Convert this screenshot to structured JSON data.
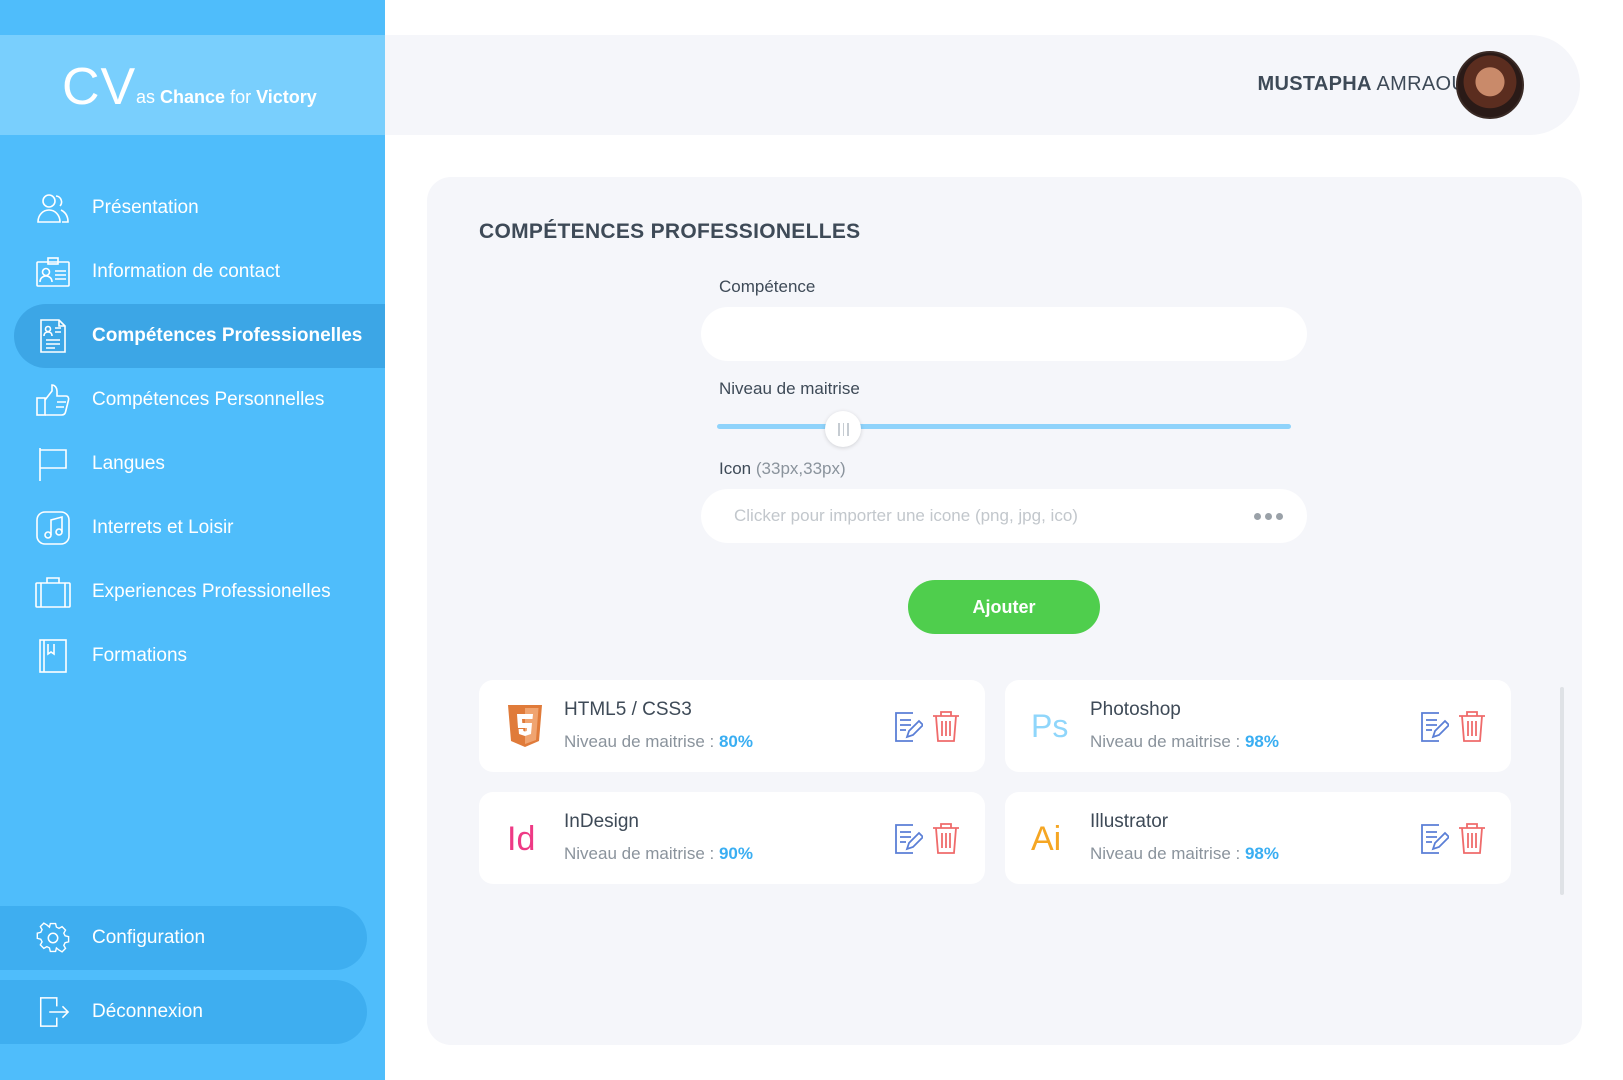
{
  "app": {
    "logo_main": "CV",
    "logo_as": "as",
    "logo_chance": "Chance",
    "logo_for": "for",
    "logo_victory": "Victory"
  },
  "sidebar": {
    "items": [
      {
        "label": "Présentation",
        "icon": "users-icon"
      },
      {
        "label": "Information de contact",
        "icon": "contact-card-icon"
      },
      {
        "label": "Compétences Professionelles",
        "icon": "document-icon",
        "active": true
      },
      {
        "label": "Compétences Personnelles",
        "icon": "thumbs-up-icon"
      },
      {
        "label": "Langues",
        "icon": "flag-icon"
      },
      {
        "label": "Interrets et Loisir",
        "icon": "music-icon"
      },
      {
        "label": "Experiences Professionelles",
        "icon": "briefcase-icon"
      },
      {
        "label": "Formations",
        "icon": "book-icon"
      }
    ],
    "config_label": "Configuration",
    "logout_label": "Déconnexion"
  },
  "header": {
    "first_name": "MUSTAPHA",
    "last_name": "AMRAOUI"
  },
  "form": {
    "title": "COMPÉTENCES PROFESSIONELLES",
    "skill_label": "Compétence",
    "skill_value": "",
    "level_label": "Niveau de maitrise",
    "level_value": 0.22,
    "icon_label": "Icon",
    "icon_hint": "(33px,33px)",
    "icon_placeholder": "Clicker pour importer une icone (png, jpg, ico)",
    "submit_label": "Ajouter"
  },
  "skills": [
    {
      "name": "HTML5 / CSS3",
      "level_label": "Niveau de maitrise :",
      "level": "80%",
      "icon": "html5-icon"
    },
    {
      "name": "Photoshop",
      "level_label": "Niveau de maitrise :",
      "level": "98%",
      "icon": "photoshop-icon"
    },
    {
      "name": "InDesign",
      "level_label": "Niveau de maitrise :",
      "level": "90%",
      "icon": "indesign-icon"
    },
    {
      "name": "Illustrator",
      "level_label": "Niveau de maitrise :",
      "level": "98%",
      "icon": "illustrator-icon"
    }
  ],
  "colors": {
    "sidebar": "#4fbdfb",
    "accent_green": "#4fce4d",
    "percent_blue": "#3aaef2",
    "delete_red": "#ef6b6b",
    "edit_blue": "#5b7fd6"
  }
}
